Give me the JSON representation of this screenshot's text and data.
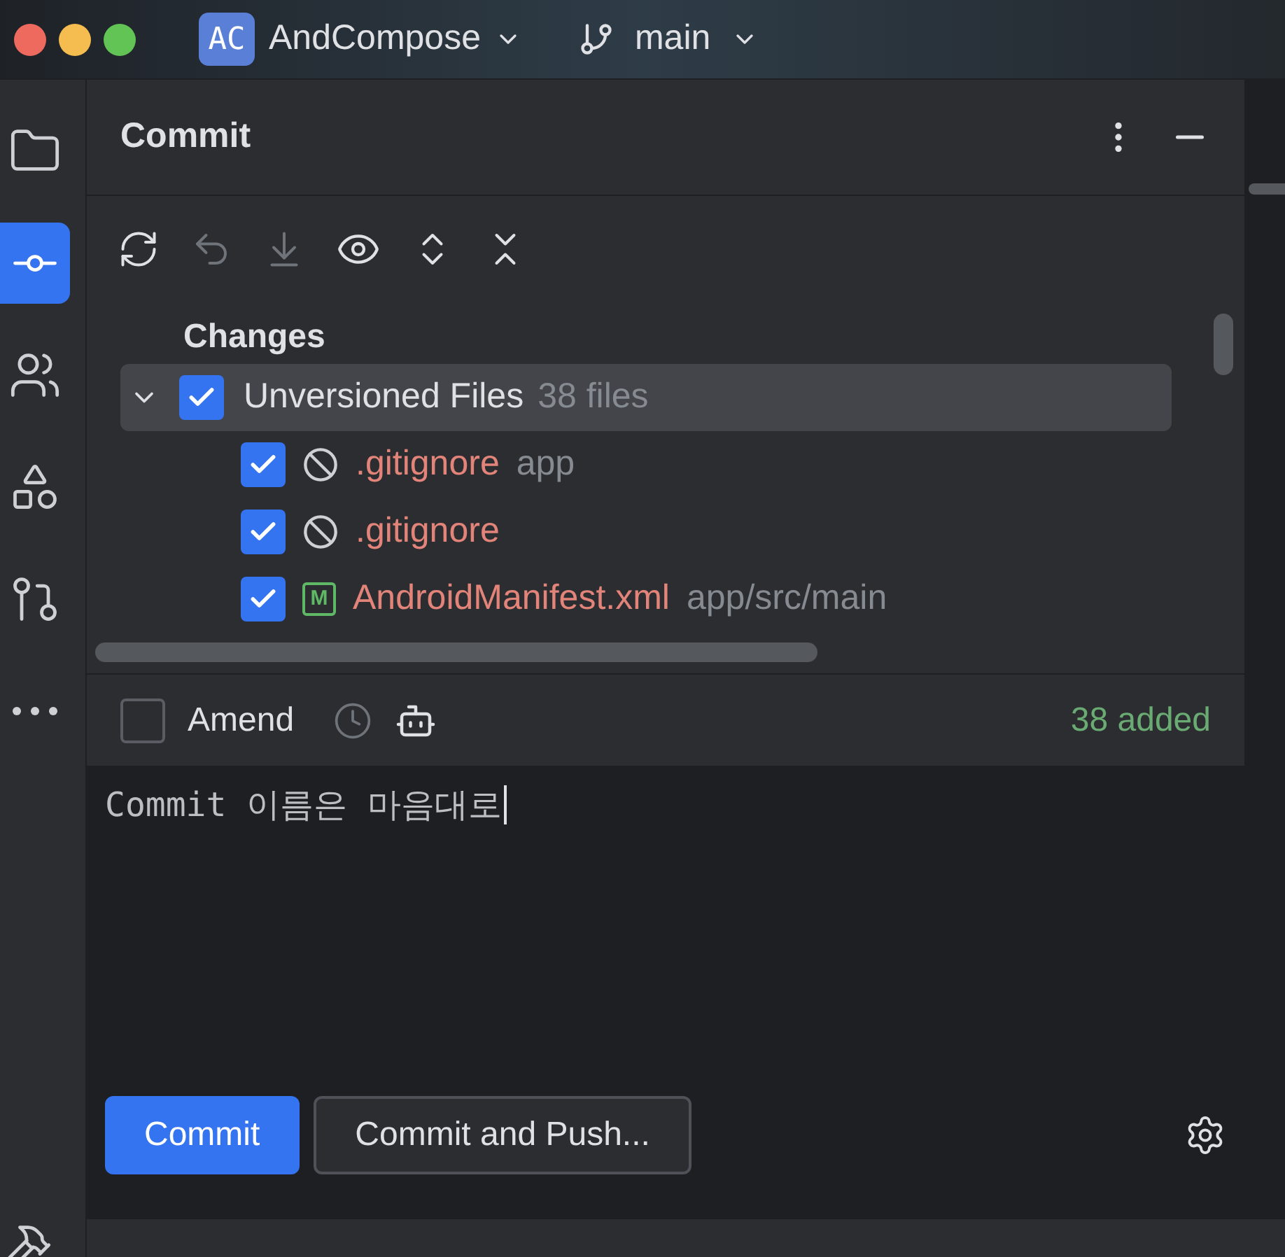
{
  "titlebar": {
    "project_badge": "AC",
    "project": "AndCompose",
    "branch": "main"
  },
  "panel": {
    "title": "Commit"
  },
  "tree": {
    "section": "Changes",
    "group": {
      "label": "Unversioned Files",
      "count": "38 files",
      "expanded": true,
      "checked": true,
      "selected": true,
      "children": [
        {
          "name": ".gitignore",
          "path": "app",
          "checked": true,
          "kind": "ignored"
        },
        {
          "name": ".gitignore",
          "checked": true,
          "kind": "ignored"
        },
        {
          "name": "AndroidManifest.xml",
          "path": "app/src/main",
          "checked": true,
          "kind": "manifest",
          "badge": "M"
        }
      ]
    }
  },
  "amend": {
    "label": "Amend",
    "checked": false
  },
  "summary": "38 added",
  "message": {
    "value": "Commit 이름은 마음대로"
  },
  "buttons": [
    {
      "label": "Commit",
      "kind": "primary"
    },
    {
      "label": "Commit and Push...",
      "kind": "secondary"
    }
  ]
}
